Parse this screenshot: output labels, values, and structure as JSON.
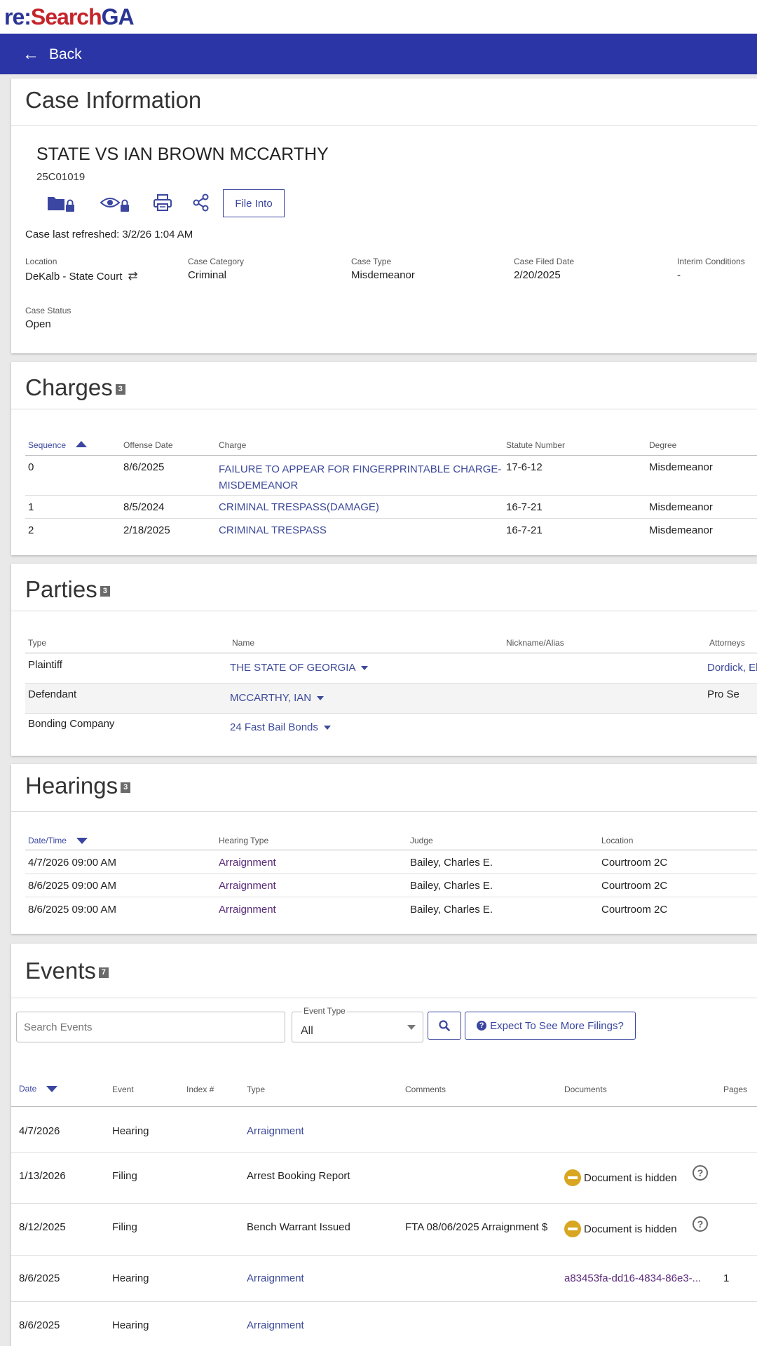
{
  "header": {
    "logo_re": "re:",
    "logo_search": "Search",
    "logo_ga": "GA",
    "back_label": "Back"
  },
  "case_info": {
    "section_title": "Case Information",
    "case_title": "STATE VS IAN BROWN MCCARTHY",
    "case_number": "25C01019",
    "file_into_label": "File Into",
    "refreshed": "Case last refreshed: 3/2/26 1:04 AM",
    "fields": {
      "location_label": "Location",
      "location_value": "DeKalb - State Court",
      "category_label": "Case Category",
      "category_value": "Criminal",
      "type_label": "Case Type",
      "type_value": "Misdemeanor",
      "filed_label": "Case Filed Date",
      "filed_value": "2/20/2025",
      "interim_label": "Interim Conditions",
      "interim_value": "-",
      "status_label": "Case Status",
      "status_value": "Open"
    }
  },
  "charges": {
    "section_title": "Charges",
    "count": "3",
    "columns": [
      "Sequence",
      "Offense Date",
      "Charge",
      "Statute Number",
      "Degree"
    ],
    "rows": [
      {
        "sequence": "0",
        "offense_date": "8/6/2025",
        "charge_line1": "FAILURE TO APPEAR FOR FINGERPRINTABLE CHARGE-",
        "charge_line2": "MISDEMEANOR",
        "statute": "17-6-12",
        "degree": "Misdemeanor"
      },
      {
        "sequence": "1",
        "offense_date": "8/5/2024",
        "charge_line1": "CRIMINAL TRESPASS(DAMAGE)",
        "charge_line2": "",
        "statute": "16-7-21",
        "degree": "Misdemeanor"
      },
      {
        "sequence": "2",
        "offense_date": "2/18/2025",
        "charge_line1": "CRIMINAL TRESPASS",
        "charge_line2": "",
        "statute": "16-7-21",
        "degree": "Misdemeanor"
      }
    ]
  },
  "parties": {
    "section_title": "Parties",
    "count": "3",
    "columns": [
      "Type",
      "Name",
      "Nickname/Alias",
      "Attorneys"
    ],
    "rows": [
      {
        "type": "Plaintiff",
        "name": "THE STATE OF GEORGIA",
        "alias": "",
        "attorneys": "Dordick, El"
      },
      {
        "type": "Defendant",
        "name": "MCCARTHY, IAN",
        "alias": "",
        "attorneys": "Pro Se"
      },
      {
        "type": "Bonding Company",
        "name": "24 Fast Bail Bonds",
        "alias": "",
        "attorneys": ""
      }
    ]
  },
  "hearings": {
    "section_title": "Hearings",
    "count": "3",
    "columns": [
      "Date/Time",
      "Hearing Type",
      "Judge",
      "Location"
    ],
    "rows": [
      {
        "datetime": "4/7/2026 09:00 AM",
        "type": "Arraignment",
        "judge": "Bailey, Charles E.",
        "location": "Courtroom 2C"
      },
      {
        "datetime": "8/6/2025 09:00 AM",
        "type": "Arraignment",
        "judge": "Bailey, Charles E.",
        "location": "Courtroom 2C"
      },
      {
        "datetime": "8/6/2025 09:00 AM",
        "type": "Arraignment",
        "judge": "Bailey, Charles E.",
        "location": "Courtroom 2C"
      }
    ]
  },
  "events": {
    "section_title": "Events",
    "count": "7",
    "search_placeholder": "Search Events",
    "event_type_label": "Event Type",
    "event_type_value": "All",
    "expect_label": "Expect To See More Filings?",
    "columns": [
      "Date",
      "Event",
      "Index #",
      "Type",
      "Comments",
      "Documents",
      "Pages"
    ],
    "rows": [
      {
        "date": "4/7/2026",
        "event": "Hearing",
        "index": "",
        "type": "Arraignment",
        "comments": "",
        "document": "",
        "pages": ""
      },
      {
        "date": "1/13/2026",
        "event": "Filing",
        "index": "",
        "type": "Arrest Booking Report",
        "comments": "",
        "document": "Document is hidden",
        "pages": ""
      },
      {
        "date": "8/12/2025",
        "event": "Filing",
        "index": "",
        "type": "Bench Warrant Issued",
        "comments": "FTA 08/06/2025 Arraignment $",
        "document": "Document is hidden",
        "pages": ""
      },
      {
        "date": "8/6/2025",
        "event": "Hearing",
        "index": "",
        "type": "Arraignment",
        "comments": "",
        "document": "a83453fa-dd16-4834-86e3-...",
        "pages": "1"
      },
      {
        "date": "8/6/2025",
        "event": "Hearing",
        "index": "",
        "type": "Arraignment",
        "comments": "",
        "document": "",
        "pages": ""
      }
    ]
  }
}
